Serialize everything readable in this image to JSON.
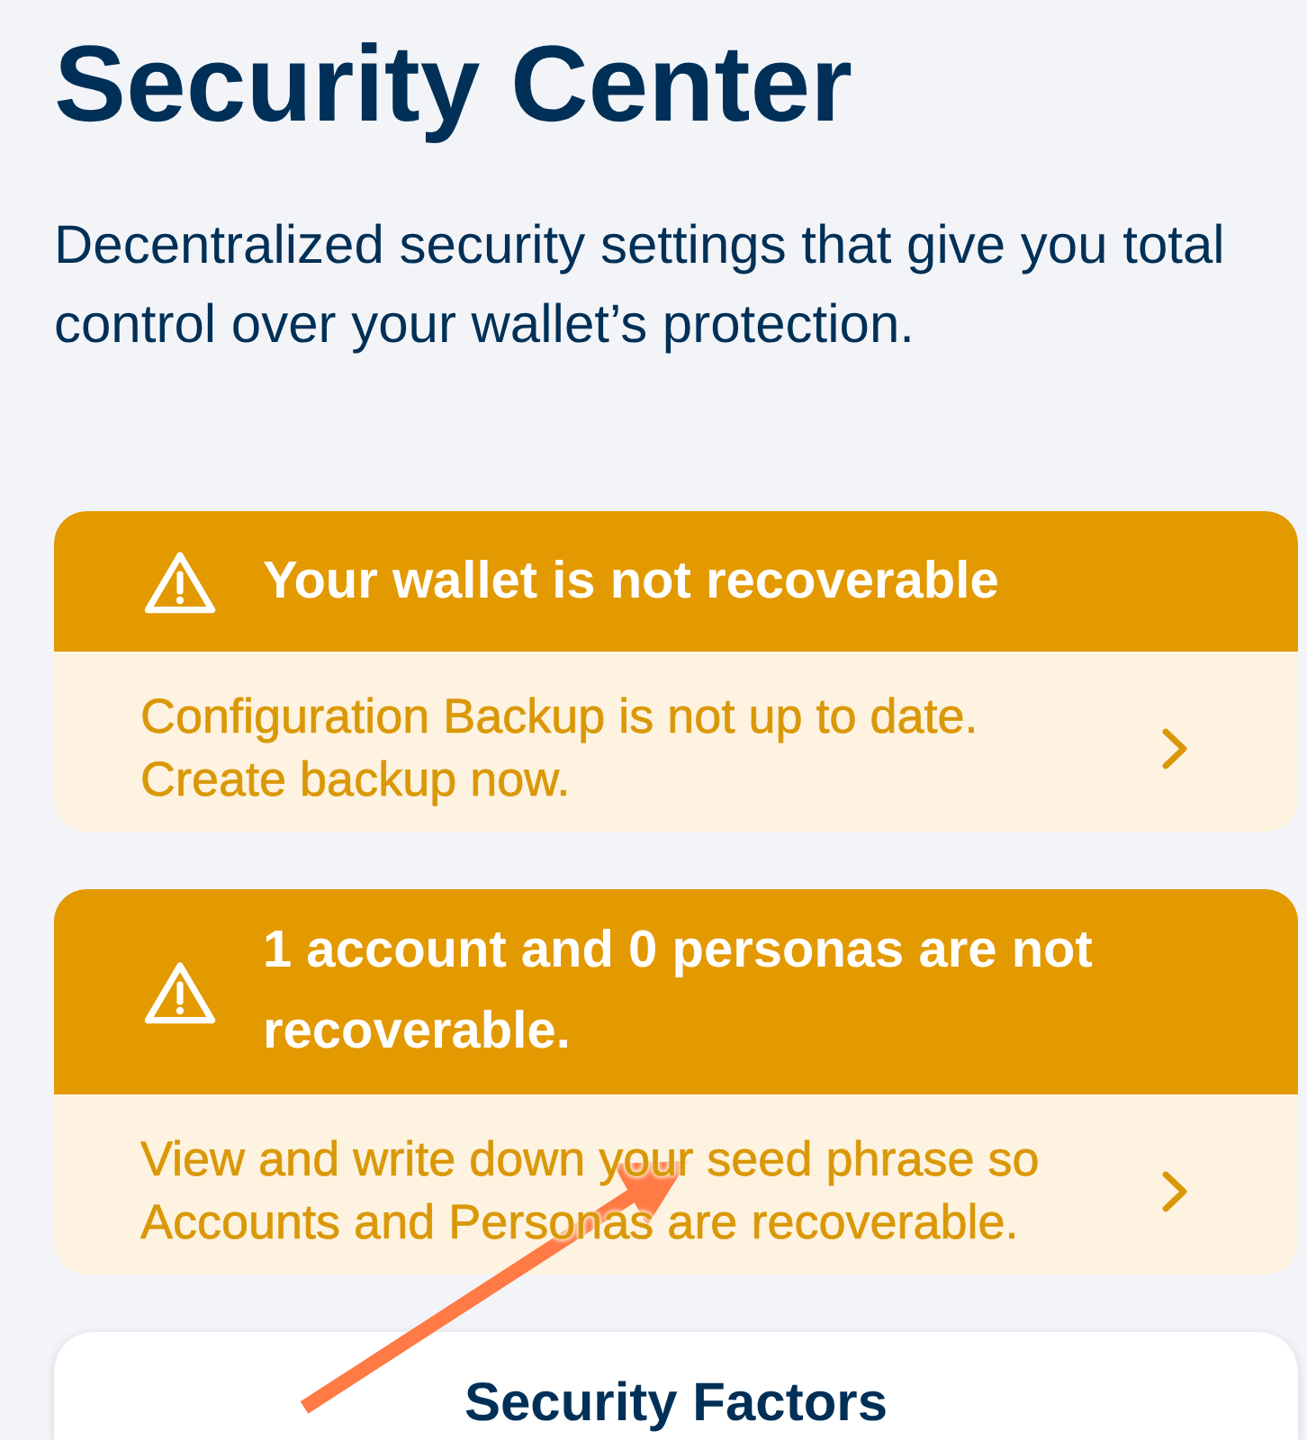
{
  "page": {
    "title": "Security Center",
    "subtitle": "Decentralized security settings that give you total control over your wallet’s protection."
  },
  "alerts": [
    {
      "kind": "warning",
      "title": "Your wallet is not recoverable",
      "message": "Configuration Backup is not up to date. Create backup now."
    },
    {
      "kind": "warning",
      "title": "1 account and 0 personas are not recoverable.",
      "message": "View and write down your seed phrase so Accounts and Personas are recoverable."
    }
  ],
  "security_factors_card": {
    "title": "Security Factors"
  },
  "annotations": [
    {
      "kind": "arrow"
    }
  ]
}
